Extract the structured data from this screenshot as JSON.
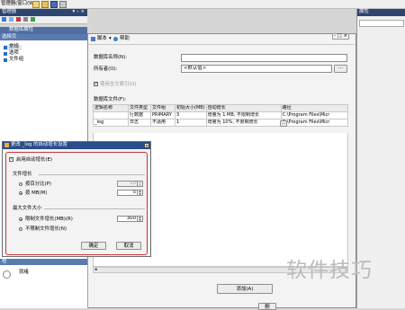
{
  "topbar": {
    "menu_label": "窗口(W)",
    "menu_prefix": "管理器(",
    "menu_suffix": ")"
  },
  "left_panel": {
    "title": "管理器",
    "close_glyph": "▾ ₊ ×",
    "header": "数据库属性",
    "group_label": "选择页",
    "items": [
      "常规",
      "选项",
      "文件组"
    ]
  },
  "right_small_panel": {
    "title": "属性"
  },
  "dialog": {
    "toolbar": {
      "script_label": "脚本",
      "help_label": "帮助"
    },
    "window_controls": "- □ ×",
    "fields": [
      {
        "label": "数据库名称(N):",
        "value": ""
      },
      {
        "label": "所有者(O):",
        "value": "<默认值>"
      }
    ],
    "fulltext_label": "使用全文索引(U)",
    "files_label": "数据库文件(F):",
    "columns": [
      "逻辑名称",
      "文件类型",
      "文件组",
      "初始大小(MB)",
      "自动增长",
      "路径"
    ],
    "rows": [
      [
        "",
        "行数据",
        "PRIMARY",
        "3",
        "增量为 1 MB, 不限制增长",
        "C:\\Program Files\\Micr"
      ],
      [
        "_log",
        "日志",
        "不适用",
        "1",
        "增量为 10%, 不限制增长",
        "C:\\Program Files\\Micr"
      ]
    ],
    "add_button": "添加(A)",
    "remove_button": "删"
  },
  "growth_dialog": {
    "title": "更改 _log 的自动增长设置",
    "enable_label": "启用自动增长(E)",
    "growth_section": "文件增长",
    "percent_label": "按百分比(P)",
    "percent_value": "10",
    "mb_label": "按 MB(M)",
    "mb_value": "5",
    "maxsize_section": "最大文件大小",
    "limit_label": "限制文件增长(MB)(R)",
    "limit_value": "300",
    "unlimited_label": "不限制文件增长(N)",
    "ok_label": "确定",
    "cancel_label": "取消"
  },
  "bottom_panel": {
    "header": "程",
    "item": "就绪"
  },
  "watermark": "软件技巧",
  "colors": {
    "accent": "#c8363c",
    "title_blue": "#2a4d8c",
    "select_highlight": "#dce8f6"
  },
  "icons": [
    "script-icon",
    "help-icon",
    "page-icon",
    "folder-icon",
    "ellipsis-icon"
  ]
}
